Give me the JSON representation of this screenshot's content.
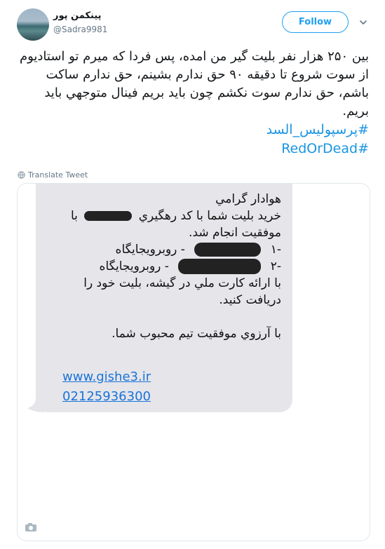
{
  "user": {
    "display_name": "پینکمن پور",
    "handle": "@Sadra9981"
  },
  "follow_label": "Follow",
  "tweet": {
    "body": "بین ۲۵۰ هزار نفر بلیت گیر من امده، پس فردا که میرم تو استادیوم از سوت شروع تا دقیقه ۹۰ حق ندارم بشینم، حق ندارم ساکت باشم، حق ندارم سوت نکشم چون باید بریم فینال متوجهي باید بریم.",
    "hashtags": [
      "#پرسپولیس_السد",
      "#RedOrDead"
    ]
  },
  "translate_label": "Translate Tweet",
  "sms": {
    "greeting": "هوادار گرامي",
    "line2_pre": "خريد بليت شما با کد رهگيري",
    "line2_post": "با",
    "line3": "موفقيت انجام شد.",
    "item1_num": "-۱",
    "item1_text": "- روبرويجايگاه",
    "item2_num": "-۲",
    "item2_text": "- روبرويجايگاه",
    "line6": "با ارائه کارت ملي در گيشه، بليت خود را",
    "line7": "دريافت کنيد.",
    "wish": "با آرزوي موفقيت تيم محبوب شما.",
    "website": "www.gishe3.ir",
    "phone": "02125936300"
  },
  "icons": {
    "chevron": "chevron-down-icon",
    "globe": "globe-icon",
    "camera": "camera-icon"
  },
  "colors": {
    "brand": "#1da1f2",
    "hashtag": "#1b95e0",
    "bubble": "#e5e5ea"
  }
}
